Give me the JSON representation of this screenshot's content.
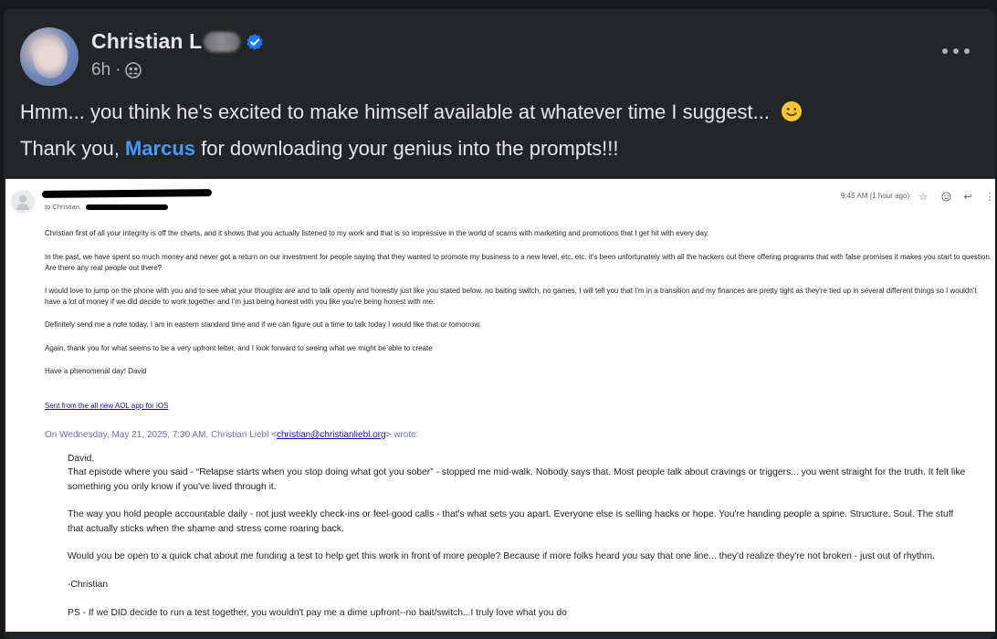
{
  "post": {
    "author_name": "Christian L",
    "timestamp": "6h",
    "separator": "·",
    "audience_icon": "friends-icon",
    "line1": "Hmm... you think he's excited to make himself available at whatever time I suggest...",
    "line2_before": "Thank you,",
    "mention": "Marcus",
    "line2_after": "for downloading your genius into the prompts!!!"
  },
  "email": {
    "to_line": "to Christian,",
    "time": "9:45 AM (1 hour ago)",
    "paragraphs": [
      "Christian first of all your integrity is off the charts, and it shows that you actually listened to my work and that is so impressive in the world of scams with marketing and promotions that I get hit with every day.",
      "In the past, we have spent so much money and never got a return on our investment for people saying that they wanted to promote my business to a new level, etc. etc. it's been unfortunately with all the hackers out there offering programs that with false promises it makes you start to question. Are there any real people out there?",
      " I would love to jump on the phone with you and to see what your thoughts are and to talk openly and honestly just like you stated below, no baiting switch, no games, I will tell you that I'm in a transition and my finances are pretty tight as they're tied up in several different things so I wouldn't have a lot of money if we did decide to work together and I'm just being honest with you like you're being honest with me.",
      " Definitely send me a note today. I am in eastern standard time and if we can figure out a time to talk today I would like that or tomorrow.",
      "Again, thank you for what seems to be a very upfront letter, and I look forward to seeing what we might be able to create",
      "Have a phenomenal day! David"
    ],
    "signature_link": "Sent from the all new AOL app for iOS",
    "quote_header_before": "On Wednesday, May 21, 2025, 7:30 AM, Christian Liebl <",
    "quote_email": "christian@christianliebl.org",
    "quote_header_after": "> wrote:",
    "quote": [
      "David,",
      "That episode where you said - “Relapse starts when you stop doing what got you sober” - stopped me mid-walk. Nobody says that. Most people talk about cravings or triggers... you went straight for the truth. It felt like something you only know if you've lived through it.",
      "The way you hold people accountable daily - not just weekly check-ins or feel-good calls - that's what sets you apart. Everyone else is selling hacks or hope. You're handing people a spine. Structure. Soul. The stuff that actually sticks when the shame and stress come roaring back.",
      "Would you be open to a quick chat about me funding a test to help get this work in front of more people? Because if more folks heard you say that one line... they'd realize they're not broken - just out of rhythm.",
      "-Christian",
      "PS - If we DID decide to run a test together, you wouldn't pay me a dime upfront--no bait/switch...I truly love what you do"
    ]
  },
  "colors": {
    "background": "#18191a",
    "card": "#242526",
    "text_primary": "#e4e6eb",
    "text_secondary": "#b0b3b8",
    "mention": "#4599ff",
    "verified": "#1877f2"
  }
}
